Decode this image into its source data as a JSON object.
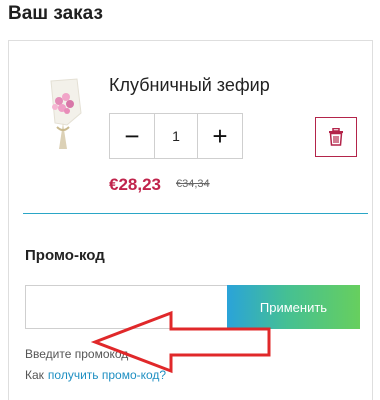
{
  "page": {
    "title": "Ваш заказ"
  },
  "product": {
    "name": "Клубничный зефир",
    "quantity": "1",
    "minus_label": "−",
    "plus_label": "+",
    "price": "€28,23",
    "old_price": "€34,34"
  },
  "promo": {
    "title": "Промо-код",
    "input_value": "",
    "apply_label": "Применить",
    "hint": "Введите промокод",
    "how_prefix": "Как",
    "how_link": "получить промо-код?"
  },
  "colors": {
    "accent": "#c0244c",
    "divider": "#2aa6c6",
    "link": "#1e8fc2",
    "arrow": "#e0282a"
  }
}
